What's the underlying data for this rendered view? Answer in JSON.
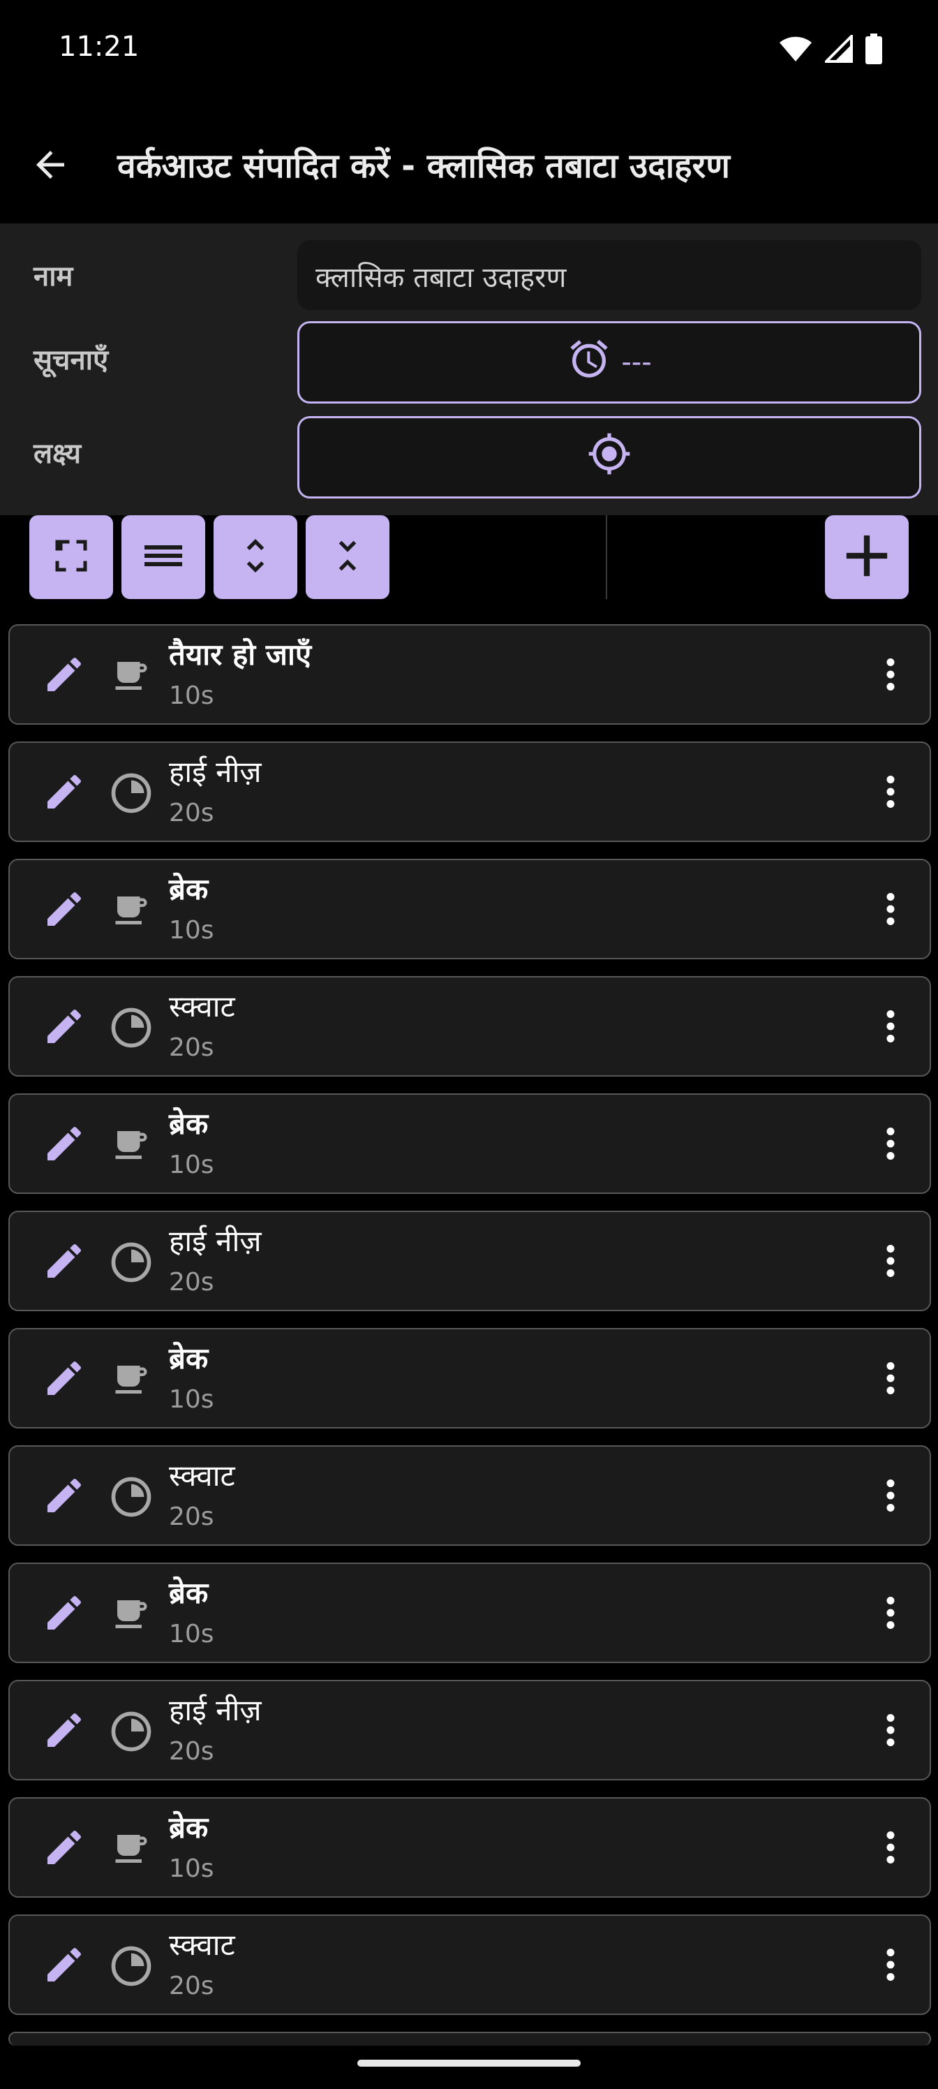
{
  "status": {
    "time": "11:21",
    "icons": [
      "wifi-icon",
      "signal-icon",
      "battery-icon"
    ]
  },
  "app_bar": {
    "back_icon": "arrow-left-icon",
    "title": "वर्कआउट संपादित करें - क्लासिक तबाटा उदाहरण"
  },
  "settings": {
    "name_label": "नाम",
    "name_value": "क्लासिक तबाटा उदाहरण",
    "notifications_label": "सूचनाएँ",
    "notifications_value": "---",
    "notifications_icon": "alarm-clock-icon",
    "target_label": "लक्ष्य",
    "target_icon": "crosshair-icon"
  },
  "toolbar": {
    "buttons": [
      "expand-icon",
      "list-icon",
      "unfold-more-icon",
      "unfold-less-icon"
    ],
    "add_icon": "plus-icon"
  },
  "colors": {
    "accent": "#c6b4f2",
    "background": "#000000",
    "panel": "#1e1e1f",
    "item_bg": "#1b1b1c",
    "item_border": "#585858"
  },
  "items": [
    {
      "name": "तैयार हो जाएँ",
      "duration": "10s",
      "type": "break"
    },
    {
      "name": "हाई नीज़",
      "duration": "20s",
      "type": "exercise"
    },
    {
      "name": "ब्रेक",
      "duration": "10s",
      "type": "break"
    },
    {
      "name": "स्क्वाट",
      "duration": "20s",
      "type": "exercise"
    },
    {
      "name": "ब्रेक",
      "duration": "10s",
      "type": "break"
    },
    {
      "name": "हाई नीज़",
      "duration": "20s",
      "type": "exercise"
    },
    {
      "name": "ब्रेक",
      "duration": "10s",
      "type": "break"
    },
    {
      "name": "स्क्वाट",
      "duration": "20s",
      "type": "exercise"
    },
    {
      "name": "ब्रेक",
      "duration": "10s",
      "type": "break"
    },
    {
      "name": "हाई नीज़",
      "duration": "20s",
      "type": "exercise"
    },
    {
      "name": "ब्रेक",
      "duration": "10s",
      "type": "break"
    },
    {
      "name": "स्क्वाट",
      "duration": "20s",
      "type": "exercise"
    }
  ]
}
